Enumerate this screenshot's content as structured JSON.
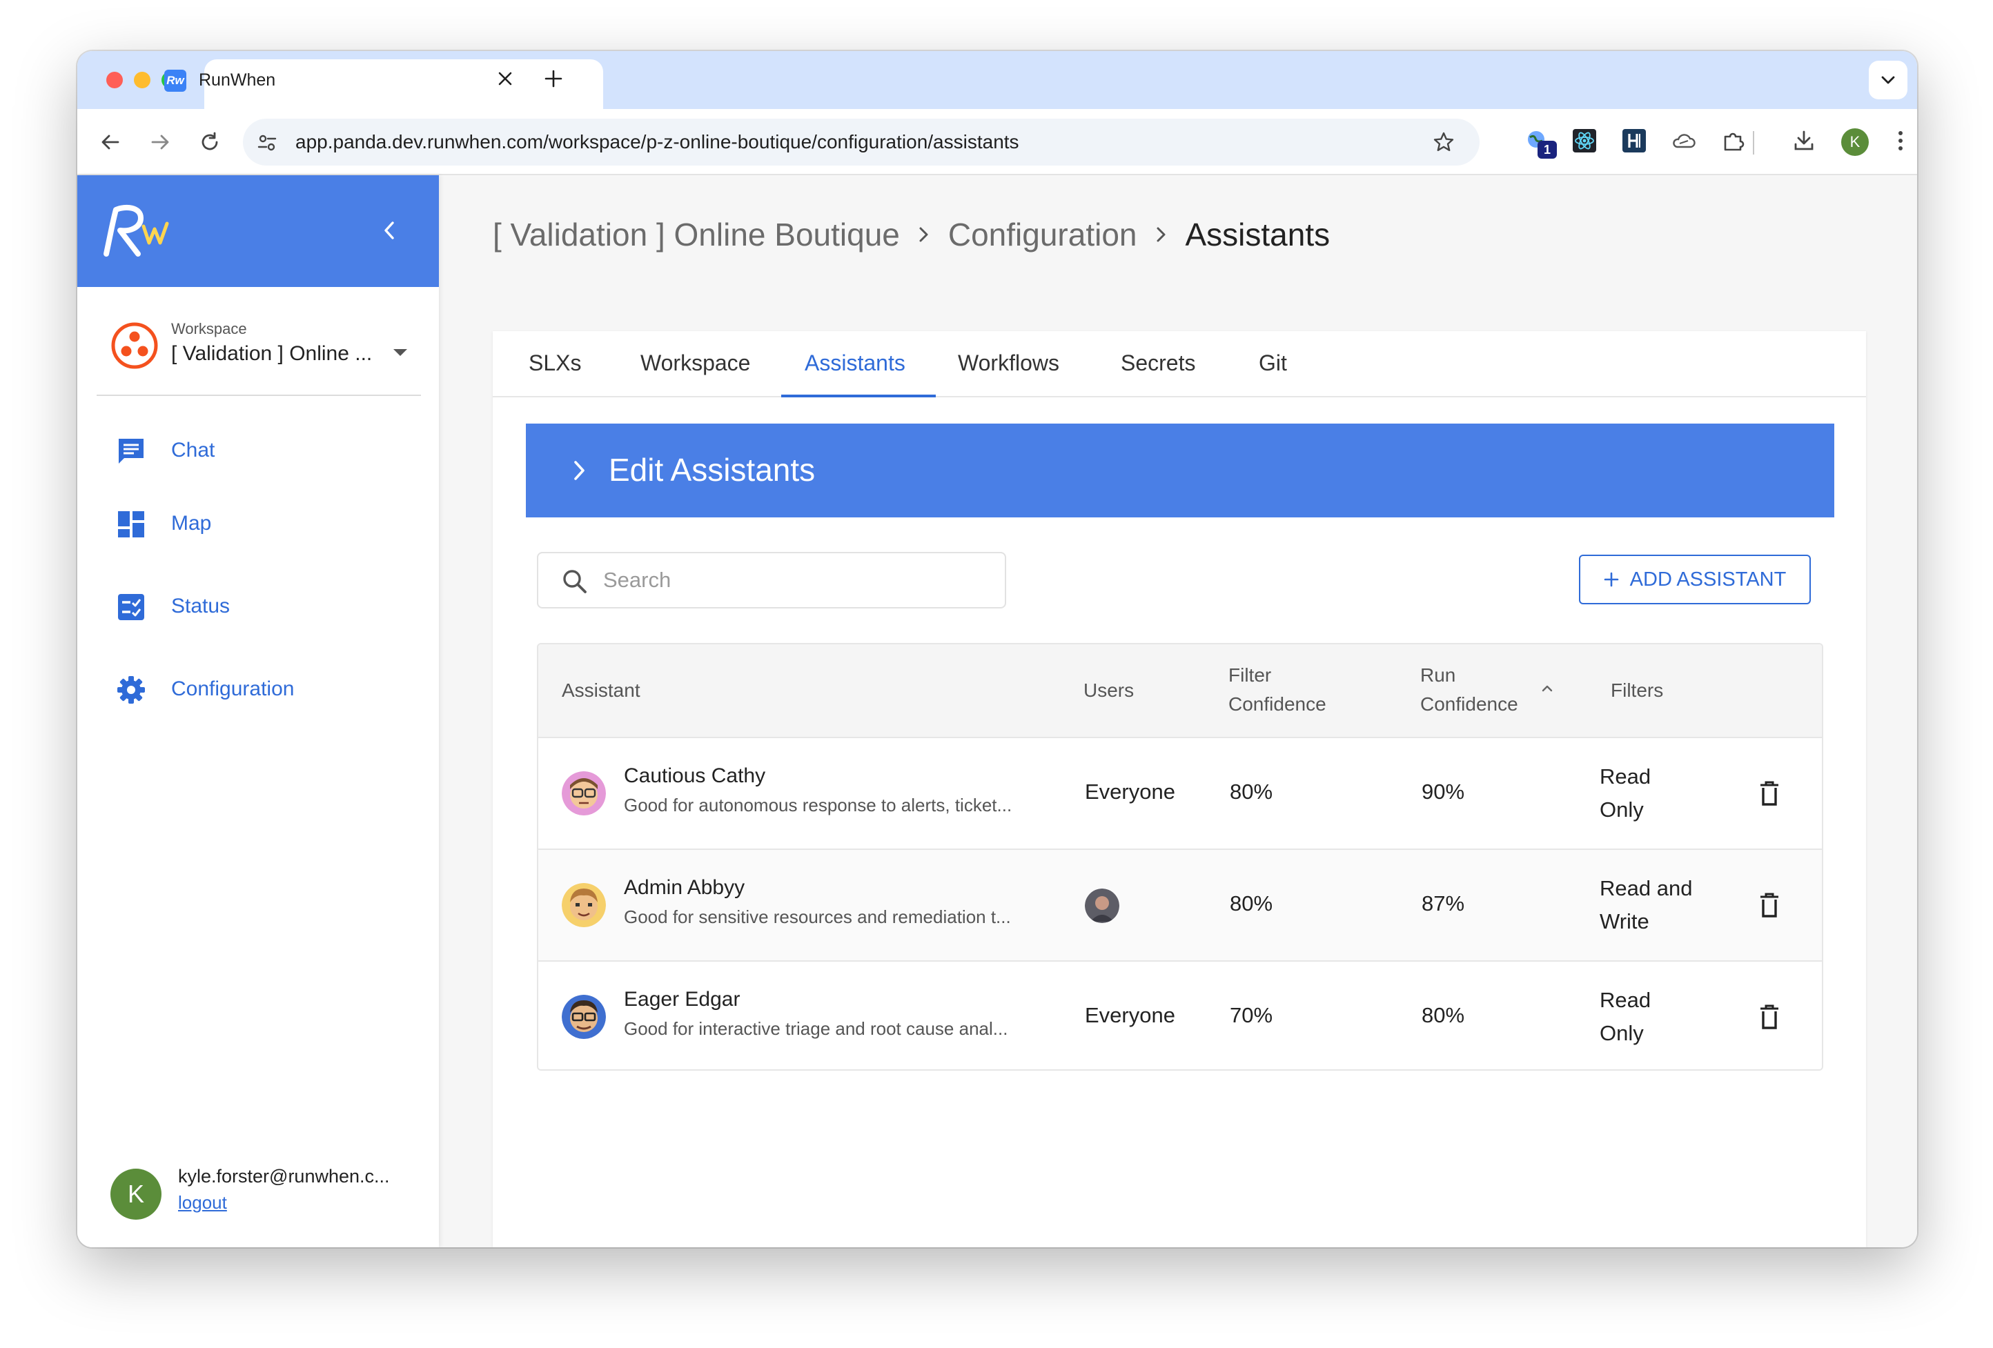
{
  "browser": {
    "tab_title": "RunWhen",
    "favicon_text": "Rw",
    "url": "app.panda.dev.runwhen.com/workspace/p-z-online-boutique/configuration/assistants",
    "extension_badge": "1",
    "profile_initial": "K"
  },
  "sidebar": {
    "logo_text": "Rw",
    "workspace_label": "Workspace",
    "workspace_name": "[ Validation ] Online ...",
    "nav": [
      {
        "label": "Chat",
        "icon": "chat-icon"
      },
      {
        "label": "Map",
        "icon": "map-icon"
      },
      {
        "label": "Status",
        "icon": "status-icon"
      },
      {
        "label": "Configuration",
        "icon": "gear-icon"
      }
    ],
    "user": {
      "initial": "K",
      "email": "kyle.forster@runwhen.c...",
      "logout": "logout"
    }
  },
  "breadcrumb": [
    "[ Validation ] Online Boutique",
    "Configuration",
    "Assistants"
  ],
  "tabs": [
    "SLXs",
    "Workspace",
    "Assistants",
    "Workflows",
    "Secrets",
    "Git"
  ],
  "active_tab": "Assistants",
  "section": {
    "title": "Edit Assistants"
  },
  "search": {
    "placeholder": "Search",
    "value": ""
  },
  "add_button": {
    "label": "ADD ASSISTANT"
  },
  "table": {
    "headers": {
      "assistant": "Assistant",
      "users": "Users",
      "filter_confidence_1": "Filter",
      "filter_confidence_2": "Confidence",
      "run_confidence_1": "Run",
      "run_confidence_2": "Confidence",
      "filters": "Filters"
    },
    "sort": {
      "column": "run_confidence",
      "direction": "ascending"
    },
    "rows": [
      {
        "name": "Cautious Cathy",
        "description": "Good for autonomous response to alerts, ticket...",
        "users": "Everyone",
        "filter_confidence": "80%",
        "run_confidence": "90%",
        "filters_1": "Read",
        "filters_2": "Only"
      },
      {
        "name": "Admin Abbyy",
        "description": "Good for sensitive resources and remediation t...",
        "users": "",
        "filter_confidence": "80%",
        "run_confidence": "87%",
        "filters_1": "Read and",
        "filters_2": "Write"
      },
      {
        "name": "Eager Edgar",
        "description": "Good for interactive triage and root cause anal...",
        "users": "Everyone",
        "filter_confidence": "70%",
        "run_confidence": "80%",
        "filters_1": "Read",
        "filters_2": "Only"
      }
    ]
  },
  "colors": {
    "brand_blue": "#4a7fe6",
    "link_blue": "#2f6bd8",
    "workspace_icon": "#f4511e",
    "user_avatar": "#5b8d3a"
  }
}
